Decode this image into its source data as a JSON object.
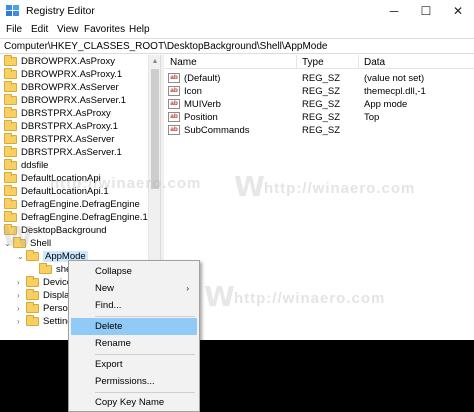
{
  "window": {
    "title": "Registry Editor",
    "minimize_glyph": "─",
    "maximize_glyph": "☐",
    "close_glyph": "✕"
  },
  "menubar": {
    "items": [
      "File",
      "Edit",
      "View",
      "Favorites",
      "Help"
    ]
  },
  "address": {
    "path": "Computer\\HKEY_CLASSES_ROOT\\DesktopBackground\\Shell\\AppMode"
  },
  "tree": {
    "items": [
      {
        "label": "DBROWPRX.AsProxy",
        "has_chevron": false
      },
      {
        "label": "DBROWPRX.AsProxy.1",
        "has_chevron": false
      },
      {
        "label": "DBROWPRX.AsServer",
        "has_chevron": false
      },
      {
        "label": "DBROWPRX.AsServer.1",
        "has_chevron": false
      },
      {
        "label": "DBRSTPRX.AsProxy",
        "has_chevron": false
      },
      {
        "label": "DBRSTPRX.AsProxy.1",
        "has_chevron": false
      },
      {
        "label": "DBRSTPRX.AsServer",
        "has_chevron": false
      },
      {
        "label": "DBRSTPRX.AsServer.1",
        "has_chevron": false
      },
      {
        "label": "ddsfile",
        "has_chevron": false
      },
      {
        "label": "DefaultLocationApi",
        "has_chevron": false
      },
      {
        "label": "DefaultLocationApi.1",
        "has_chevron": false
      },
      {
        "label": "DefragEngine.DefragEngine",
        "has_chevron": false
      },
      {
        "label": "DefragEngine.DefragEngine.1",
        "has_chevron": false
      },
      {
        "label": "DesktopBackground",
        "has_chevron": false
      },
      {
        "label": "Shell",
        "has_chevron": true,
        "expanded": true
      },
      {
        "label": "AppMode",
        "has_chevron": true,
        "expanded": true,
        "selected": true
      },
      {
        "label": "she",
        "has_chevron": false
      },
      {
        "label": "Device",
        "has_chevron": true
      },
      {
        "label": "Display",
        "has_chevron": true
      },
      {
        "label": "Person",
        "has_chevron": true
      },
      {
        "label": "Setting",
        "has_chevron": true
      }
    ]
  },
  "values": {
    "columns": {
      "name": "Name",
      "type": "Type",
      "data": "Data"
    },
    "rows": [
      {
        "name": "(Default)",
        "type": "REG_SZ",
        "data": "(value not set)"
      },
      {
        "name": "Icon",
        "type": "REG_SZ",
        "data": "themecpl.dll,-1"
      },
      {
        "name": "MUIVerb",
        "type": "REG_SZ",
        "data": "App mode"
      },
      {
        "name": "Position",
        "type": "REG_SZ",
        "data": "Top"
      },
      {
        "name": "SubCommands",
        "type": "REG_SZ",
        "data": ""
      }
    ],
    "icon_text": "ab"
  },
  "watermark": {
    "text": "http://winaero.com",
    "letter": "W"
  },
  "context_menu": {
    "items": [
      {
        "label": "Collapse",
        "submenu": false
      },
      {
        "label": "New",
        "submenu": true
      },
      {
        "label": "Find...",
        "submenu": false
      },
      {
        "label": "Delete",
        "submenu": false,
        "highlighted": true
      },
      {
        "label": "Rename",
        "submenu": false
      },
      {
        "label": "Export",
        "submenu": false
      },
      {
        "label": "Permissions...",
        "submenu": false
      },
      {
        "label": "Copy Key Name",
        "submenu": false
      }
    ],
    "submenu_glyph": "›"
  },
  "colors": {
    "selection": "#cce8ff",
    "menu_highlight": "#91c9f7",
    "folder": "#f7cf62"
  }
}
